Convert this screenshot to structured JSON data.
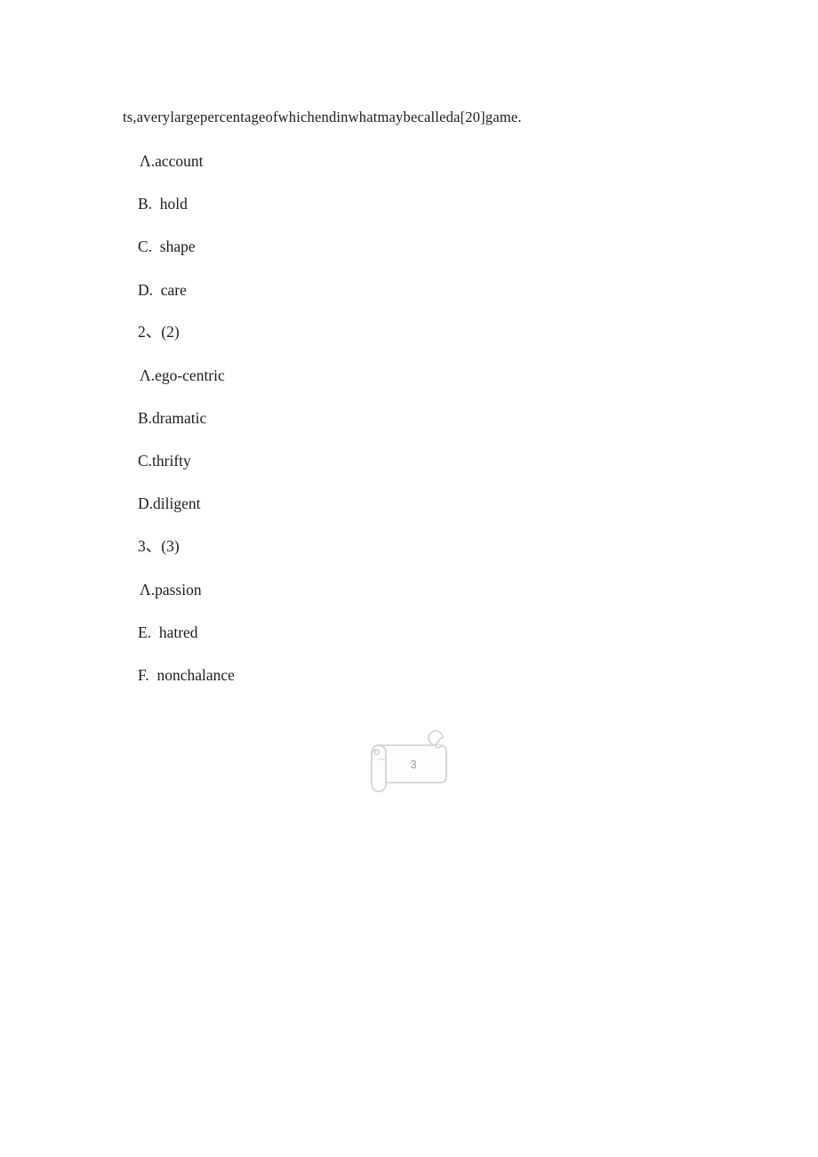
{
  "document": {
    "background_color": "#ffffff",
    "text_color": "#1c1c1c",
    "lead_line": "ts,averylargepercentageofwhichendinwhatmaybecalleda[20]game."
  },
  "questions": [
    {
      "number_label": "",
      "options": [
        {
          "label": "Λ.account"
        },
        {
          "label": "B.  hold"
        },
        {
          "label": "C.  shape"
        },
        {
          "label": "D.  care"
        }
      ]
    },
    {
      "number_label": "2、(2)",
      "options": [
        {
          "label": "Λ.ego-centric"
        },
        {
          "label": "B.dramatic"
        },
        {
          "label": "C.thrifty"
        },
        {
          "label": "D.diligent"
        }
      ]
    },
    {
      "number_label": "3、(3)",
      "options": [
        {
          "label": "Λ.passion"
        },
        {
          "label": "E.  hatred"
        },
        {
          "label": "F.  nonchalance"
        }
      ]
    }
  ],
  "page_marker": {
    "icon": "scroll-icon",
    "page_number": "3",
    "stroke_color": "#a9a9a9",
    "fill_color": "#fdfdfd",
    "number_color": "#9b9b9b"
  }
}
